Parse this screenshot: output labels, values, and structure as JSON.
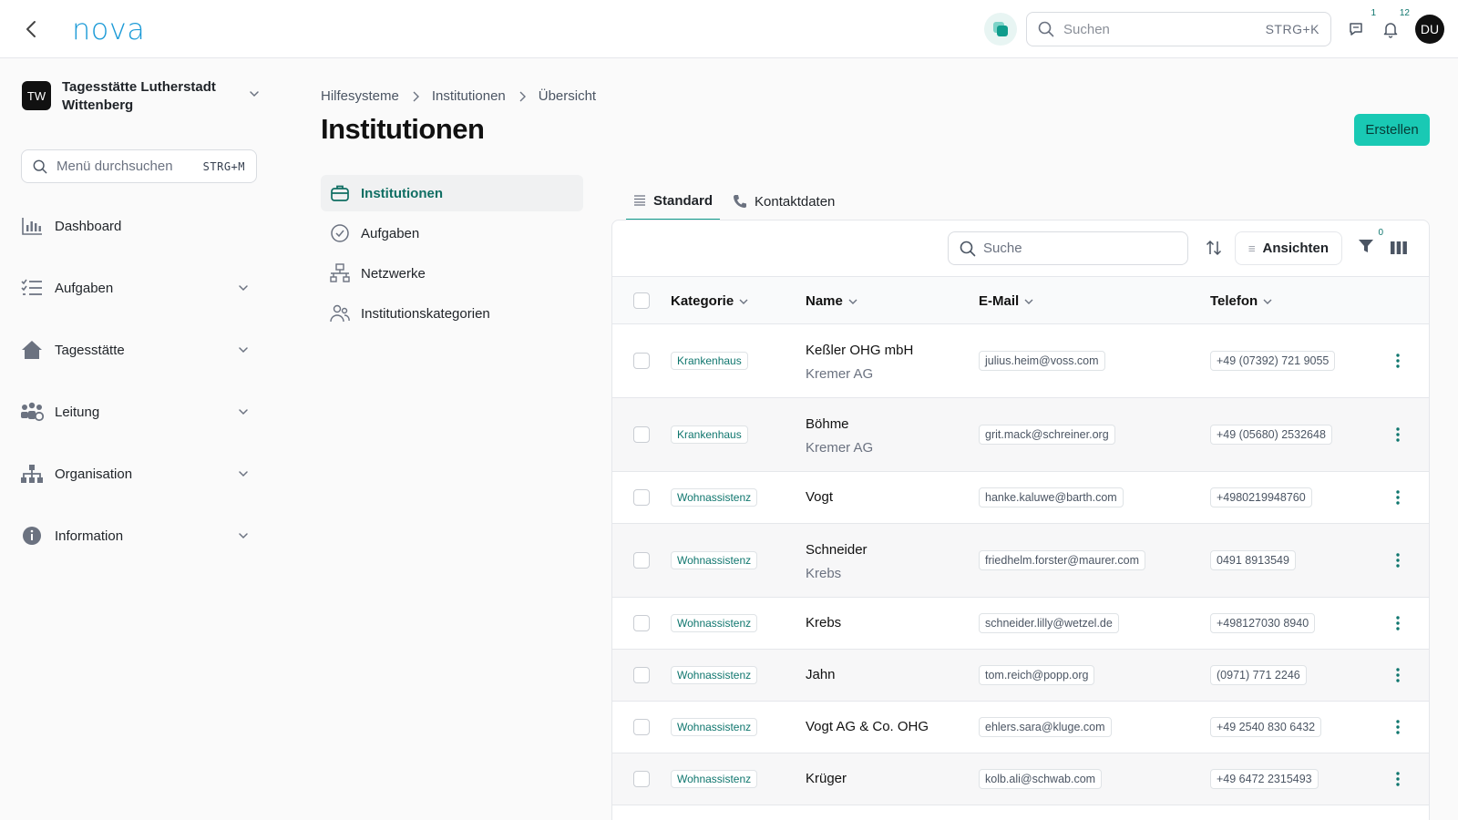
{
  "app": {
    "logo": "nova",
    "user_initials": "DU"
  },
  "topbar": {
    "search_placeholder": "Suchen",
    "search_shortcut": "STRG+K",
    "chat_badge": "1",
    "notifications_badge": "12"
  },
  "sidebar": {
    "org_initials": "TW",
    "org_name": "Tagesstätte Lutherstadt Wittenberg",
    "search_placeholder": "Menü durchsuchen",
    "search_shortcut": "STRG+M",
    "items": [
      {
        "label": "Dashboard",
        "icon": "chart-icon"
      },
      {
        "label": "Aufgaben",
        "icon": "checklist-icon"
      },
      {
        "label": "Tagesstätte",
        "icon": "home-icon"
      },
      {
        "label": "Leitung",
        "icon": "people-icon"
      },
      {
        "label": "Organisation",
        "icon": "org-chart-icon"
      },
      {
        "label": "Information",
        "icon": "info-icon"
      }
    ]
  },
  "breadcrumb": [
    "Hilfesysteme",
    "Institutionen",
    "Übersicht"
  ],
  "page_title": "Institutionen",
  "create_label": "Erstellen",
  "submenu": [
    {
      "label": "Institutionen",
      "icon": "briefcase-icon",
      "active": true
    },
    {
      "label": "Aufgaben",
      "icon": "check-circle-icon",
      "active": false
    },
    {
      "label": "Netzwerke",
      "icon": "network-icon",
      "active": false
    },
    {
      "label": "Institutionskategorien",
      "icon": "users-icon",
      "active": false
    }
  ],
  "tabs": [
    {
      "label": "Standard",
      "icon": "list-icon",
      "active": true
    },
    {
      "label": "Kontaktdaten",
      "icon": "phone-icon",
      "active": false
    }
  ],
  "table": {
    "search_placeholder": "Suche",
    "views_label": "Ansichten",
    "filter_count": "0",
    "columns": [
      "Kategorie",
      "Name",
      "E-Mail",
      "Telefon"
    ],
    "rows": [
      {
        "category": "Krankenhaus",
        "name": "Keßler OHG mbH",
        "sub": "Kremer AG",
        "email": "julius.heim@voss.com",
        "phone": "+49 (07392) 721 9055"
      },
      {
        "category": "Krankenhaus",
        "name": "Böhme",
        "sub": "Kremer AG",
        "email": "grit.mack@schreiner.org",
        "phone": "+49 (05680) 2532648"
      },
      {
        "category": "Wohnassistenz",
        "name": "Vogt",
        "sub": "",
        "email": "hanke.kaluwe@barth.com",
        "phone": "+4980219948760"
      },
      {
        "category": "Wohnassistenz",
        "name": "Schneider",
        "sub": "Krebs",
        "email": "friedhelm.forster@maurer.com",
        "phone": "0491 8913549"
      },
      {
        "category": "Wohnassistenz",
        "name": "Krebs",
        "sub": "",
        "email": "schneider.lilly@wetzel.de",
        "phone": "+498127030 8940"
      },
      {
        "category": "Wohnassistenz",
        "name": "Jahn",
        "sub": "",
        "email": "tom.reich@popp.org",
        "phone": "(0971) 771 2246"
      },
      {
        "category": "Wohnassistenz",
        "name": "Vogt AG & Co. OHG",
        "sub": "",
        "email": "ehlers.sara@kluge.com",
        "phone": "+49 2540 830 6432"
      },
      {
        "category": "Wohnassistenz",
        "name": "Krüger",
        "sub": "",
        "email": "kolb.ali@schwab.com",
        "phone": "+49 6472 2315493"
      }
    ]
  },
  "colors": {
    "accent": "#19c9b4",
    "brand": "#1d9bd7",
    "active_text": "#0f6e63"
  }
}
